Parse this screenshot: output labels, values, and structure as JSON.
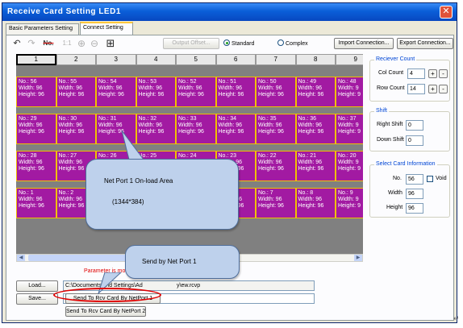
{
  "window": {
    "title": "Receive Card Setting LED1",
    "close_glyph": "✕"
  },
  "tabs": [
    {
      "label": "Basic Parameters Setting",
      "active": false
    },
    {
      "label": "Connect Setting",
      "active": true
    }
  ],
  "toolbar": {
    "icons": [
      "undo-icon",
      "redo-icon",
      "number-icon",
      "ratio-icon",
      "zoom-in-icon",
      "zoom-out-icon",
      "grid-icon"
    ],
    "undo_glyph": "↶",
    "redo_glyph": "↷",
    "number_glyph": "No.",
    "ratio_glyph": "1:1",
    "zoom_in_glyph": "⊕",
    "zoom_out_glyph": "⊖",
    "grid_glyph": "⊞",
    "output_offset_label": "Output Offset...",
    "radio_standard": "Standard",
    "radio_complex": "Complex",
    "selected_mode": "Standard",
    "import_label": "Import Connection...",
    "export_label": "Export Connection..."
  },
  "grid": {
    "columns": [
      "1",
      "2",
      "3",
      "4",
      "5",
      "6",
      "7",
      "8",
      "9"
    ],
    "rows": [
      [
        {
          "no": "No.: 56",
          "width": "Width: 96",
          "height": "Height: 96"
        },
        {
          "no": "No.: 55",
          "width": "Width: 96",
          "height": "Height: 96"
        },
        {
          "no": "No.: 54",
          "width": "Width: 96",
          "height": "Height: 96"
        },
        {
          "no": "No.: 53",
          "width": "Width: 96",
          "height": "Height: 96"
        },
        {
          "no": "No.: 52",
          "width": "Width: 96",
          "height": "Height: 96"
        },
        {
          "no": "No.: 51",
          "width": "Width: 96",
          "height": "Height: 96"
        },
        {
          "no": "No.: 50",
          "width": "Width: 96",
          "height": "Height: 96"
        },
        {
          "no": "No.: 49",
          "width": "Width: 96",
          "height": "Height: 96"
        },
        {
          "no": "No.: 48",
          "width": "Width: 9",
          "height": "Height: 9"
        }
      ],
      [
        {
          "no": "No.: 29",
          "width": "Width: 96",
          "height": "Height: 96"
        },
        {
          "no": "No.: 30",
          "width": "Width: 96",
          "height": "Height: 96"
        },
        {
          "no": "No.: 31",
          "width": "Width: 96",
          "height": "Height: 96"
        },
        {
          "no": "No.: 32",
          "width": "Width: 96",
          "height": "Height: 96"
        },
        {
          "no": "No.: 33",
          "width": "Width: 96",
          "height": "Height: 96"
        },
        {
          "no": "No.: 34",
          "width": "Width: 96",
          "height": "Height: 96"
        },
        {
          "no": "No.: 35",
          "width": "Width: 96",
          "height": "Height: 96"
        },
        {
          "no": "No.: 36",
          "width": "Width: 96",
          "height": "Height: 96"
        },
        {
          "no": "No.: 37",
          "width": "Width: 9",
          "height": "Height: 9"
        }
      ],
      [
        {
          "no": "No.: 28",
          "width": "Width: 96",
          "height": "Height: 96"
        },
        {
          "no": "No.: 27",
          "width": "Width: 96",
          "height": "Height: 96"
        },
        {
          "no": "No.: 26",
          "width": "Width: 96",
          "height": "Height: 96"
        },
        {
          "no": "No.: 25",
          "width": "Width: 96",
          "height": "Height: 96"
        },
        {
          "no": "No.: 24",
          "width": "Width: 96",
          "height": "Height: 96"
        },
        {
          "no": "No.: 23",
          "width": "Width: 96",
          "height": "Height: 96"
        },
        {
          "no": "No.: 22",
          "width": "Width: 96",
          "height": "Height: 96"
        },
        {
          "no": "No.: 21",
          "width": "Width: 96",
          "height": "Height: 96"
        },
        {
          "no": "No.: 20",
          "width": "Width: 9",
          "height": "Height: 9"
        }
      ],
      [
        {
          "no": "No.: 1",
          "width": "Width: 96",
          "height": "Height: 96"
        },
        {
          "no": "No.: 2",
          "width": "Width: 96",
          "height": "Height: 96"
        },
        {
          "no": "No.: 3",
          "width": "Width: 96",
          "height": "Height: 96"
        },
        {
          "no": "No.: 4",
          "width": "Width: 96",
          "height": "Height: 96"
        },
        {
          "no": "No.: 5",
          "width": "Width: 96",
          "height": "Height: 96"
        },
        {
          "no": "No.: 6",
          "width": "Width: 96",
          "height": "Height: 96"
        },
        {
          "no": "No.: 7",
          "width": "Width: 96",
          "height": "Height: 96"
        },
        {
          "no": "No.: 8",
          "width": "Width: 96",
          "height": "Height: 96"
        },
        {
          "no": "No.: 9",
          "width": "Width: 9",
          "height": "Height: 9"
        }
      ]
    ]
  },
  "receiver_count": {
    "legend": "Reciever Count",
    "col_label": "Col Count",
    "col_value": "4",
    "row_label": "Row Count",
    "row_value": "14",
    "plus": "+",
    "minus": "-"
  },
  "shift": {
    "legend": "Shift",
    "right_label": "Right Shift",
    "right_value": "0",
    "down_label": "Down Shift",
    "down_value": "0"
  },
  "select_card": {
    "legend": "Select Card Information",
    "no_label": "No.",
    "no_value": "56",
    "void_label": "Void",
    "width_label": "Width",
    "width_value": "96",
    "height_label": "Height",
    "height_value": "96"
  },
  "bottom": {
    "status_text": "Parameter is modif",
    "load_label": "Load...",
    "load_path": "C:\\Documents and Settings\\Ad",
    "load_path_tail": "y\\ew.rcvp",
    "save_label": "Save...",
    "send_port1_label": "Send To Rcv Card By NetPort 1",
    "send_port2_label": "Send To Rcv Card By NetPort 2"
  },
  "callouts": {
    "net_port_area_line1": "Net Port 1 On-load Area",
    "net_port_area_line2": "(1344*384)",
    "send_by_port1": "Send by Net Port 1"
  },
  "colors": {
    "cell_fill": "#a21aa2",
    "cell_border": "#f0c000",
    "callout_fill": "#bed1ec",
    "title_bar": "#0a5ed8",
    "highlight_ellipse": "#e00000"
  }
}
